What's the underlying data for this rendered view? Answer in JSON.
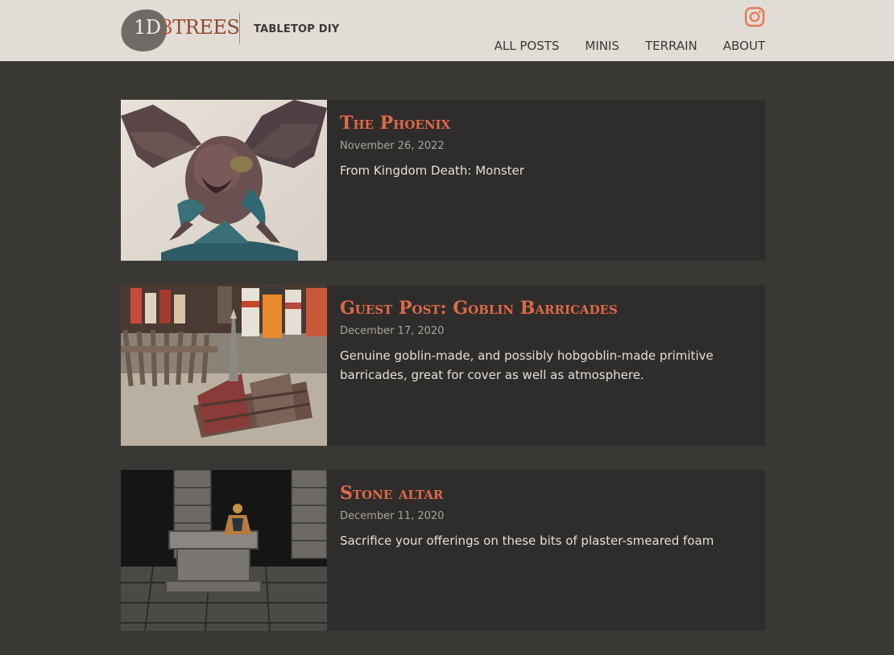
{
  "brand": {
    "logo_part1": "1D",
    "logo_part2": "3",
    "logo_part3": "TREES",
    "tagline": "TABLETOP DIY"
  },
  "nav": {
    "items": [
      "ALL POSTS",
      "MINIS",
      "TERRAIN",
      "ABOUT"
    ]
  },
  "social": {
    "icon": "instagram-icon",
    "color": "#e07a5a"
  },
  "colors": {
    "header_bg": "#e2dcd6",
    "page_bg": "#3a3835",
    "card_bg": "#2f2d2b",
    "title_accent": "#de6a48"
  },
  "posts": [
    {
      "title": "The Phoenix",
      "date": "November 26, 2022",
      "excerpt": "From Kingdom Death: Monster"
    },
    {
      "title": "Guest Post: Goblin Barricades",
      "date": "December 17, 2020",
      "excerpt": "Genuine goblin-made, and possibly hobgoblin-made primitive barricades, great for cover as well as atmosphere."
    },
    {
      "title": "Stone altar",
      "date": "December 11, 2020",
      "excerpt": "Sacrifice your offerings on these bits of plaster-smeared foam"
    }
  ]
}
